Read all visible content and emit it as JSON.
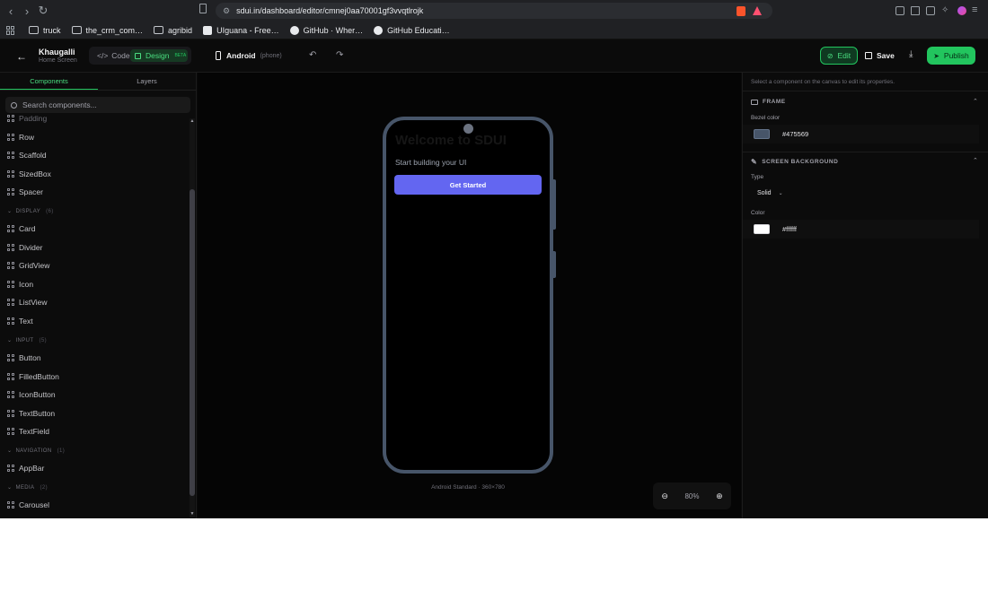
{
  "browser": {
    "url": "sdui.in/dashboard/editor/cmnej0aa70001gf3vvqtlrojk",
    "bookmarks": [
      {
        "label": "truck",
        "icon": "folder-icon"
      },
      {
        "label": "the_crm_com…",
        "icon": "folder-icon"
      },
      {
        "label": "agribid",
        "icon": "folder-icon"
      },
      {
        "label": "UIguana - Free…",
        "icon": "site-icon"
      },
      {
        "label": "GitHub · Wher…",
        "icon": "github-icon"
      },
      {
        "label": "GitHub Educati…",
        "icon": "github-icon"
      }
    ]
  },
  "header": {
    "project_name": "Khaugalli",
    "screen_name": "Home Screen",
    "mode_code": "Code",
    "mode_design": "Design",
    "mode_beta": "BETA",
    "device_name": "Android",
    "device_type": "(phone)",
    "edit_label": "Edit",
    "save_label": "Save",
    "publish_label": "Publish",
    "accent_color": "#22c55e"
  },
  "left": {
    "tab_components": "Components",
    "tab_layers": "Layers",
    "search_placeholder": "Search components...",
    "items_layout": [
      "Padding",
      "Row",
      "Scaffold",
      "SizedBox",
      "Spacer"
    ],
    "cat_display": "DISPLAY",
    "cat_display_count": "(6)",
    "items_display": [
      "Card",
      "Divider",
      "GridView",
      "Icon",
      "ListView",
      "Text"
    ],
    "cat_input": "INPUT",
    "cat_input_count": "(5)",
    "items_input": [
      "Button",
      "FilledButton",
      "IconButton",
      "TextButton",
      "TextField"
    ],
    "cat_navigation": "NAVIGATION",
    "cat_navigation_count": "(1)",
    "items_navigation": [
      "AppBar"
    ],
    "cat_media": "MEDIA",
    "cat_media_count": "(2)",
    "items_media": [
      "Carousel"
    ]
  },
  "canvas": {
    "welcome_text": "Welcome to SDUI",
    "subtitle": "Start building your UI",
    "button_label": "Get Started",
    "button_color": "#6366f1",
    "device_label": "Android Standard · 360×780",
    "zoom": "80%"
  },
  "right": {
    "hint": "Select a component on the canvas to edit its properties.",
    "frame_title": "FRAME",
    "bezel_label": "Bezel color",
    "bezel_color": "#475569",
    "bg_title": "SCREEN BACKGROUND",
    "type_label": "Type",
    "type_value": "Solid",
    "color_label": "Color",
    "bg_color": "#ffffff"
  }
}
